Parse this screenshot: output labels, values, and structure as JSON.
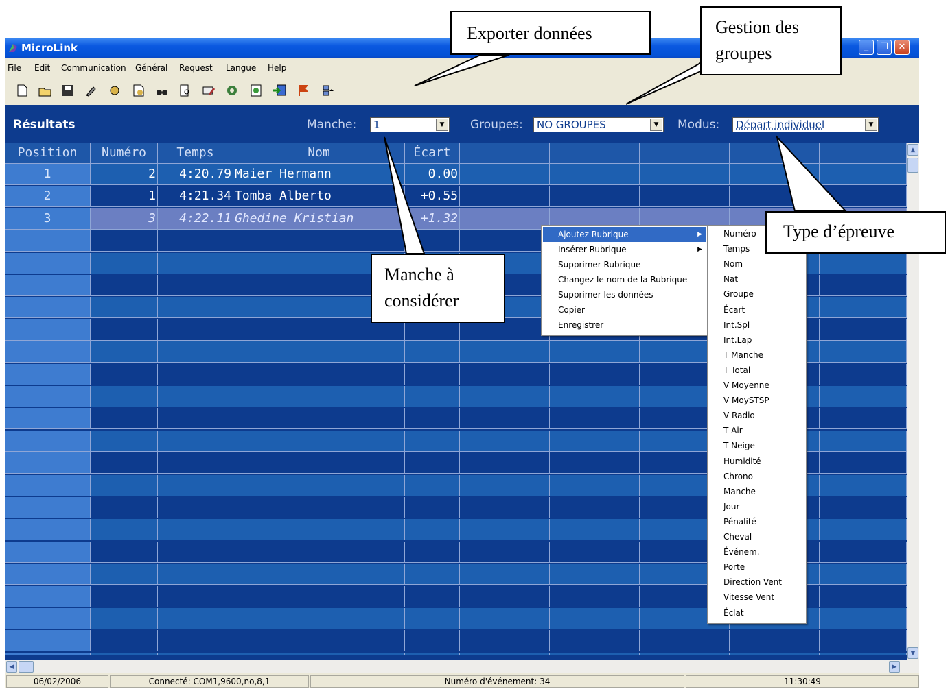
{
  "window": {
    "title": "MicroLink"
  },
  "menu": [
    "File",
    "Edit",
    "Communication",
    "Général",
    "Request",
    "Langue",
    "Help"
  ],
  "toolbar_icons": [
    "new-icon",
    "open-icon",
    "save-icon",
    "brush-icon",
    "tools-icon",
    "print-setup-icon",
    "binoculars-icon",
    "preview-icon",
    "edit-icon",
    "refresh-icon",
    "chart-icon",
    "export-icon",
    "flag-icon",
    "groups-icon"
  ],
  "panel": {
    "title": "Résultats",
    "manche_label": "Manche:",
    "manche_value": "1",
    "groupes_label": "Groupes:",
    "groupes_value": "NO GROUPES",
    "modus_label": "Modus:",
    "modus_value": "Départ individuel"
  },
  "table": {
    "headers": [
      "Position",
      "Numéro",
      "Temps",
      "Nom",
      "Écart"
    ],
    "rows": [
      {
        "pos": "1",
        "num": "2",
        "temps": "4:20.79",
        "nom": "Maier Hermann",
        "ecart": "0.00"
      },
      {
        "pos": "2",
        "num": "1",
        "temps": "4:21.34",
        "nom": "Tomba Alberto",
        "ecart": "+0.55"
      },
      {
        "pos": "3",
        "num": "3",
        "temps": "4:22.11",
        "nom": "Ghedine Kristian",
        "ecart": "+1.32"
      }
    ]
  },
  "context_menu": [
    "Ajoutez Rubrique",
    "Insérer Rubrique",
    "Supprimer Rubrique",
    "Changez le nom de la Rubrique",
    "Supprimer les données",
    "Copier",
    "Enregistrer"
  ],
  "submenu": [
    "Numéro",
    "Temps",
    "Nom",
    "Nat",
    "Groupe",
    "Écart",
    "Int.Spl",
    "Int.Lap",
    "T Manche",
    "T Total",
    "V Moyenne",
    "V MoySTSP",
    "V Radio",
    "T Air",
    "T Neige",
    "Humidité",
    "Chrono",
    "Manche",
    "Jour",
    "Pénalité",
    "Cheval",
    "Événem.",
    "Porte",
    "Direction Vent",
    "Vitesse Vent",
    "Éclat"
  ],
  "status": {
    "date": "06/02/2006",
    "connection": "Connecté: COM1,9600,no,8,1",
    "event": "Numéro d'événement: 34",
    "time": "11:30:49"
  },
  "callouts": {
    "exporter": "Exporter données",
    "gestion_l1": "Gestion des",
    "gestion_l2": "groupes",
    "manche_l1": "Manche à",
    "manche_l2": "considérer",
    "type": "Type d’épreuve"
  },
  "colors": {
    "grid_bg": "#0d3b8e",
    "position_col": "#3e7cd0",
    "row_alt": "#1d5fb0",
    "selection": "#316ac5"
  }
}
